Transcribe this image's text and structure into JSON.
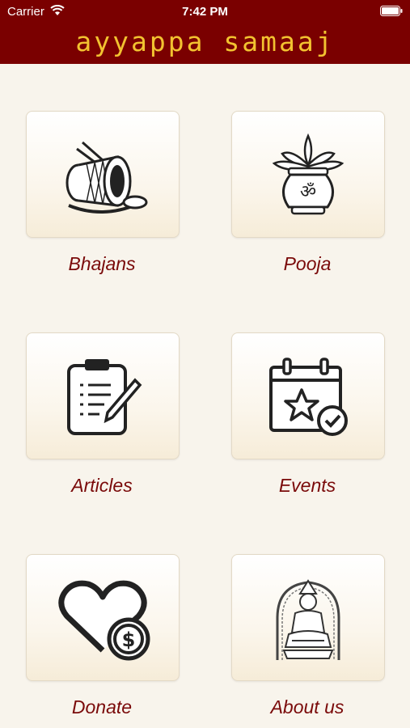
{
  "status_bar": {
    "carrier": "Carrier",
    "time": "7:42 PM"
  },
  "header": {
    "title": "ayyappa samaaj"
  },
  "menu": [
    {
      "label": "Bhajans",
      "icon": "drum-icon"
    },
    {
      "label": "Pooja",
      "icon": "kalash-icon"
    },
    {
      "label": "Articles",
      "icon": "clipboard-pencil-icon"
    },
    {
      "label": "Events",
      "icon": "calendar-star-icon"
    },
    {
      "label": "Donate",
      "icon": "heart-dollar-icon"
    },
    {
      "label": "About us",
      "icon": "ayyappa-deity-icon"
    }
  ],
  "colors": {
    "header": "#7a0000",
    "title": "#f2c230",
    "label": "#7a0a0a",
    "background": "#f8f4ec"
  }
}
